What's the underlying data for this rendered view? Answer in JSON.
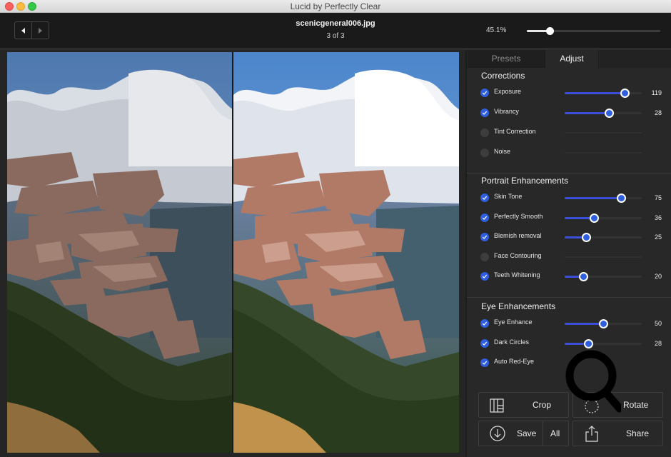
{
  "window": {
    "title": "Lucid by Perfectly Clear"
  },
  "toolbar": {
    "prev_icon": "chevron-left-icon",
    "next_icon": "chevron-right-icon",
    "filename": "scenicgeneral006.jpg",
    "file_position": "3 of 3",
    "zoom_label": "45.1%",
    "zoom_slider_fraction": 0.17
  },
  "viewer": {
    "before_label": "original image",
    "after_label": "corrected image"
  },
  "panel": {
    "tabs": [
      {
        "label": "Presets",
        "active": false
      },
      {
        "label": "Adjust",
        "active": true
      }
    ],
    "sections": [
      {
        "title": "Corrections",
        "items": [
          {
            "label": "Exposure",
            "enabled": true,
            "value": "119",
            "fraction": 0.78
          },
          {
            "label": "Vibrancy",
            "enabled": true,
            "value": "28",
            "fraction": 0.57
          },
          {
            "label": "Tint Correction",
            "enabled": false,
            "value": "",
            "fraction": 0
          },
          {
            "label": "Noise",
            "enabled": false,
            "value": "",
            "fraction": 0
          }
        ]
      },
      {
        "title": "Portrait Enhancements",
        "items": [
          {
            "label": "Skin Tone",
            "enabled": true,
            "value": "75",
            "fraction": 0.73
          },
          {
            "label": "Perfectly Smooth",
            "enabled": true,
            "value": "36",
            "fraction": 0.38
          },
          {
            "label": "Blemish removal",
            "enabled": true,
            "value": "25",
            "fraction": 0.28
          },
          {
            "label": "Face Contouring",
            "enabled": false,
            "value": "",
            "fraction": 0
          },
          {
            "label": "Teeth Whitening",
            "enabled": true,
            "value": "20",
            "fraction": 0.24
          }
        ]
      },
      {
        "title": "Eye Enhancements",
        "items": [
          {
            "label": "Eye Enhance",
            "enabled": true,
            "value": "50",
            "fraction": 0.5
          },
          {
            "label": "Dark Circles",
            "enabled": true,
            "value": "28",
            "fraction": 0.31
          },
          {
            "label": "Auto Red-Eye",
            "enabled": true,
            "value": "",
            "fraction": null
          }
        ]
      }
    ],
    "buttons": {
      "crop": "Crop",
      "rotate": "Rotate",
      "save": "Save",
      "save_all": "All",
      "share": "Share"
    }
  },
  "colors": {
    "accent": "#2f5fdf",
    "slider_fill": "#3b4fd8"
  }
}
